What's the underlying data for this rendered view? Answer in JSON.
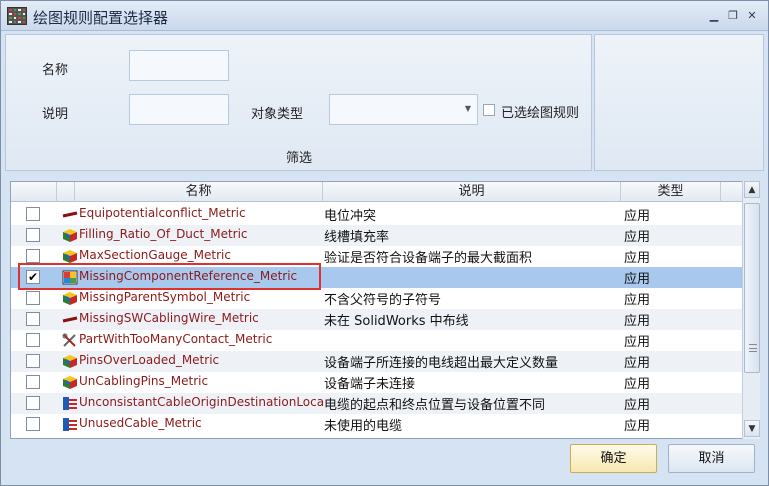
{
  "window": {
    "title": "绘图规则配置选择器",
    "controls": [
      "▁",
      "❐",
      "✕"
    ]
  },
  "filter": {
    "name_label": "名称",
    "desc_label": "说明",
    "type_label": "对象类型",
    "selected_rules_label": "已选绘图规则",
    "filter_caption": "筛选",
    "name_value": "",
    "desc_value": "",
    "type_value": ""
  },
  "grid": {
    "columns": [
      "名称",
      "说明",
      "类型"
    ],
    "rows": [
      {
        "checked": false,
        "icon": "wire-icon",
        "name": "Equipotentialconflict_Metric",
        "desc": "电位冲突",
        "type": "应用"
      },
      {
        "checked": false,
        "icon": "cube-icon",
        "name": "Filling_Ratio_Of_Duct_Metric",
        "desc": "线槽填充率",
        "type": "应用"
      },
      {
        "checked": false,
        "icon": "cube-icon",
        "name": "MaxSectionGauge_Metric",
        "desc": "验证是否符合设备端子的最大截面积",
        "type": "应用"
      },
      {
        "checked": true,
        "icon": "component-icon",
        "name": "MissingComponentReference_Metric",
        "desc": "",
        "type": "应用"
      },
      {
        "checked": false,
        "icon": "cube-icon",
        "name": "MissingParentSymbol_Metric",
        "desc": "不含父符号的子符号",
        "type": "应用"
      },
      {
        "checked": false,
        "icon": "wire-icon",
        "name": "MissingSWCablingWire_Metric",
        "desc": "未在 SolidWorks 中布线",
        "type": "应用"
      },
      {
        "checked": false,
        "icon": "tools-icon",
        "name": "PartWithTooManyContact_Metric",
        "desc": "",
        "type": "应用"
      },
      {
        "checked": false,
        "icon": "cube-icon",
        "name": "PinsOverLoaded_Metric",
        "desc": "设备端子所连接的电线超出最大定义数量",
        "type": "应用"
      },
      {
        "checked": false,
        "icon": "cube-icon",
        "name": "UnCablingPins_Metric",
        "desc": "设备端子未连接",
        "type": "应用"
      },
      {
        "checked": false,
        "icon": "cable-icon",
        "name": "UnconsistantCableOriginDestinationLocat...",
        "desc": "电缆的起点和终点位置与设备位置不同",
        "type": "应用"
      },
      {
        "checked": false,
        "icon": "cable-icon",
        "name": "UnusedCable_Metric",
        "desc": "未使用的电缆",
        "type": "应用"
      }
    ]
  },
  "buttons": {
    "ok": "确定",
    "cancel": "取消"
  }
}
